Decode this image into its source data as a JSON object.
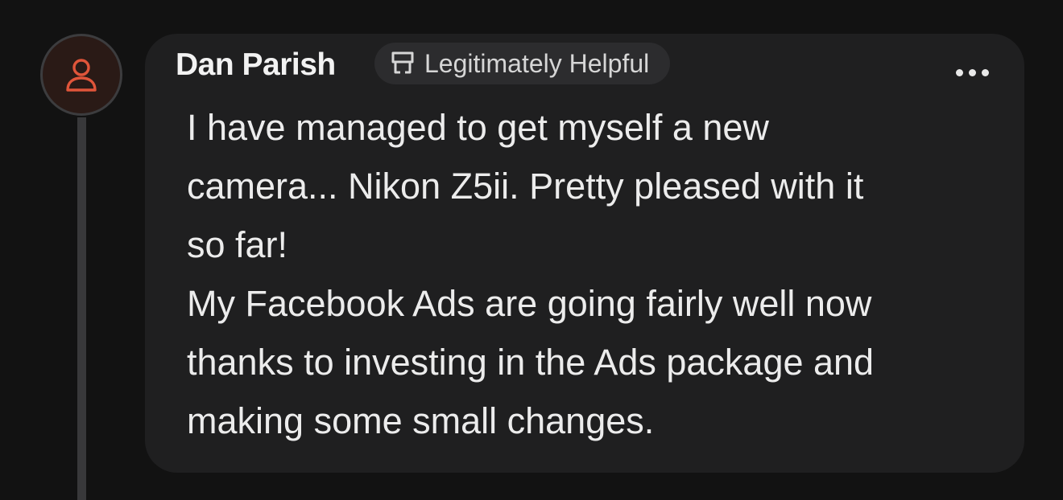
{
  "comment": {
    "author": "Dan Parish",
    "badge": {
      "label": "Legitimately Helpful",
      "icon": "badge-icon"
    },
    "menu_icon": "more-options-icon",
    "avatar_icon": "user-icon",
    "lines": [
      "I have managed to get myself a new",
      "camera... Nikon Z5ii. Pretty pleased with it",
      "so far!",
      "My Facebook Ads are going fairly well now",
      "thanks to investing in the Ads package and",
      "making some small changes."
    ]
  },
  "colors": {
    "background": "#121212",
    "bubble": "#1f1f20",
    "avatar_accent": "#e0553a",
    "badge_bg": "#2c2c2e"
  }
}
